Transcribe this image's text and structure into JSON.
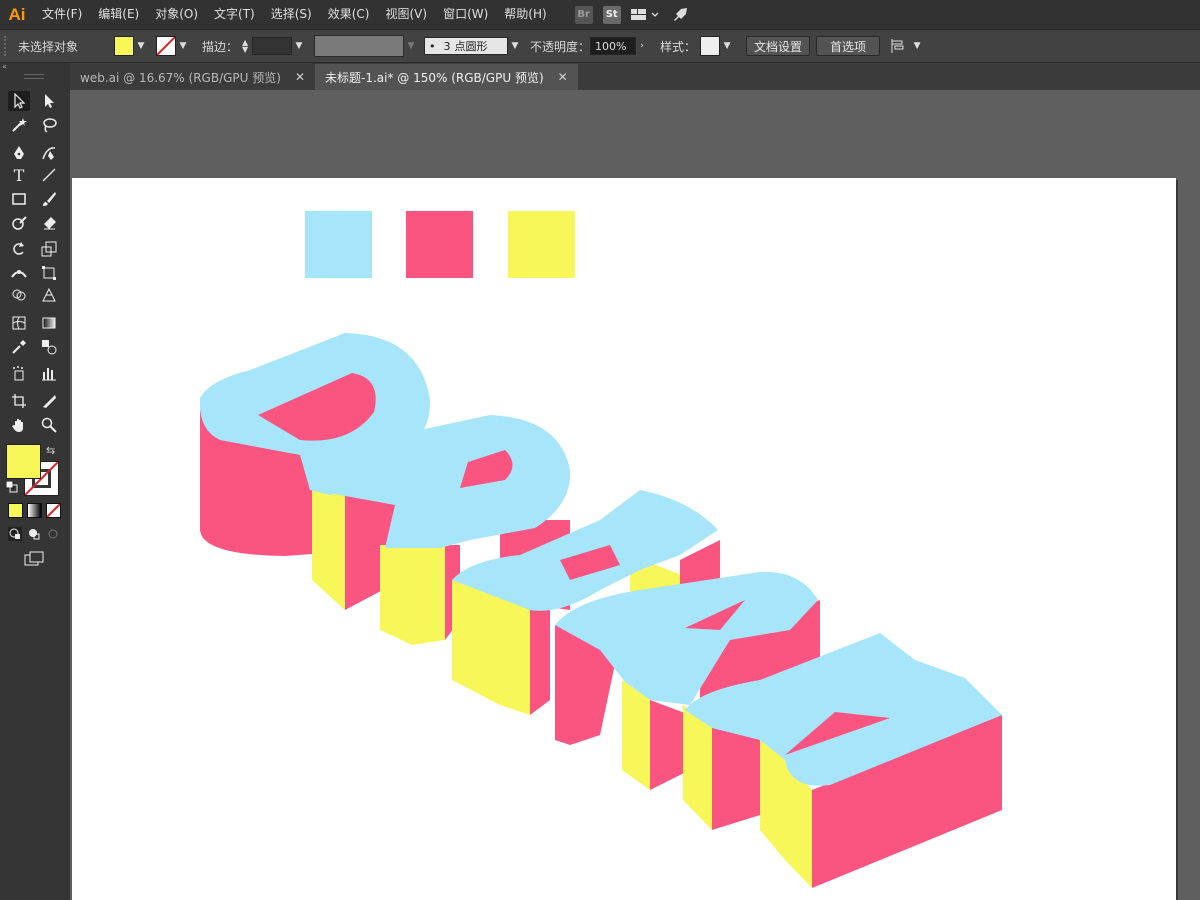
{
  "app": {
    "logo": "Ai",
    "menus": [
      "文件(F)",
      "编辑(E)",
      "对象(O)",
      "文字(T)",
      "选择(S)",
      "效果(C)",
      "视图(V)",
      "窗口(W)",
      "帮助(H)"
    ],
    "menu_icons": [
      {
        "name": "bridge-icon",
        "label": "Br"
      },
      {
        "name": "stock-icon",
        "label": "St"
      },
      {
        "name": "workspace-layout-icon",
        "label": ""
      },
      {
        "name": "rocket-icon",
        "label": ""
      }
    ]
  },
  "options_bar": {
    "selection_status": "未选择对象",
    "stroke_label": "描边：",
    "brush_size": "3",
    "brush_label": "点圆形",
    "opacity_label": "不透明度：",
    "opacity_value": "100%",
    "style_label": "样式：",
    "doc_setup_label": "文档设置",
    "preferences_label": "首选项",
    "colors": {
      "fill": "#f7f75a",
      "stroke": "none"
    }
  },
  "tabs": [
    {
      "label": "web.ai @ 16.67% (RGB/GPU 预览)",
      "active": false
    },
    {
      "label": "未标题-1.ai* @ 150% (RGB/GPU 预览)",
      "active": true
    }
  ],
  "toolbox": {
    "fill_color": "#f7f75a",
    "stroke_color": "none"
  },
  "artwork": {
    "text": "DREAM",
    "palette": [
      "#a6e5fa",
      "#fa5481",
      "#f7f75a"
    ],
    "face_color": "#a6e5fa",
    "side_color": "#fa5481",
    "depth_color": "#f7f75a"
  }
}
